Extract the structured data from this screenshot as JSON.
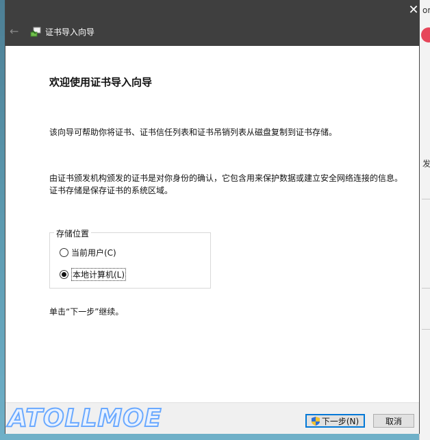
{
  "window": {
    "title": "证书导入向导",
    "close_glyph": "✕",
    "back_glyph": "←"
  },
  "main": {
    "heading": "欢迎使用证书导入向导",
    "intro": "该向导可帮助你将证书、证书信任列表和证书吊销列表从磁盘复制到证书存储。",
    "description": "由证书颁发机构颁发的证书是对你身份的确认，它包含用来保护数据或建立安全网络连接的信息。证书存储是保存证书的系统区域。",
    "store_location": {
      "label": "存储位置",
      "options": [
        {
          "label": "当前用户(C)",
          "selected": false
        },
        {
          "label": "本地计算机(L)",
          "selected": true
        }
      ]
    },
    "continue_hint": "单击“下一步”继续。"
  },
  "footer": {
    "next_label": "下一步(N)",
    "cancel_label": "取消"
  },
  "watermark": "ATOLLMOE",
  "background_window": {
    "fragments": [
      "or",
      "发"
    ]
  },
  "colors": {
    "titlebar": "#3f3f3f",
    "accent": "#0078d7"
  }
}
